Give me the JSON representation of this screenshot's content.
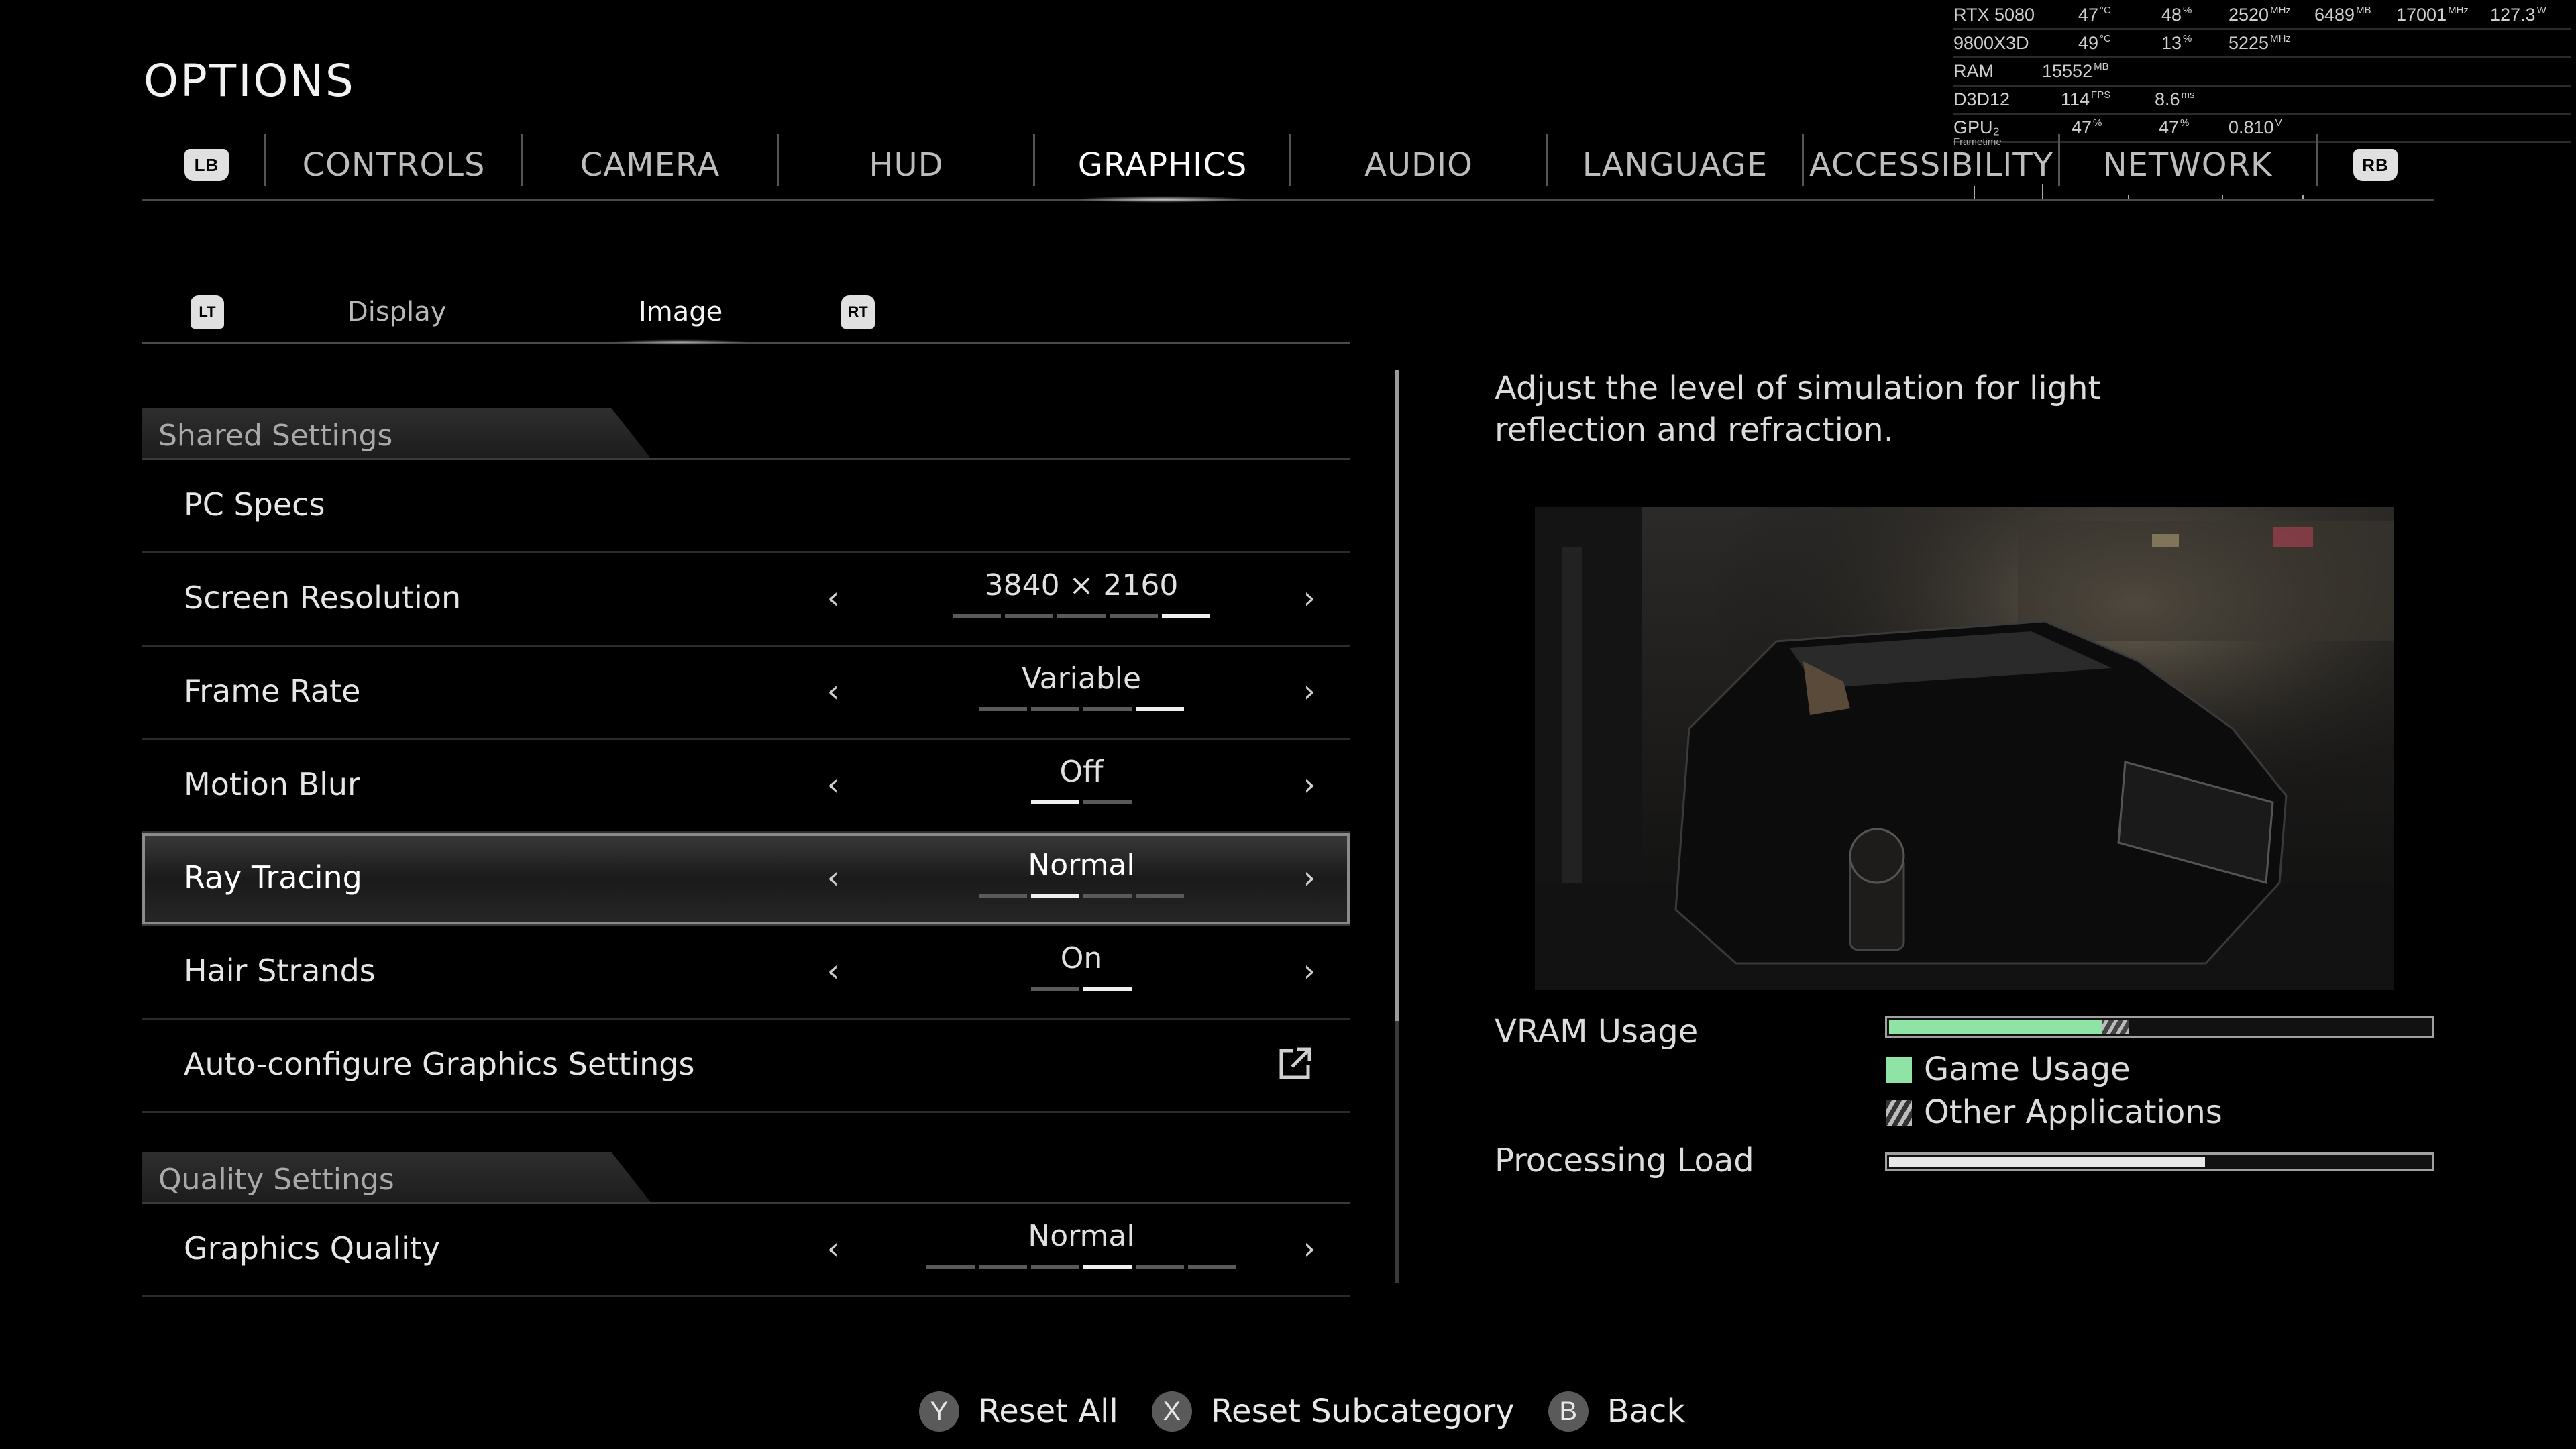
{
  "osd": {
    "rows": [
      [
        "RTX 5080",
        "47",
        "°C",
        "48",
        "%",
        "2520",
        "MHz",
        "6489",
        "MB",
        "17001",
        "MHz",
        "127.3",
        "W"
      ],
      [
        "9800X3D",
        "49",
        "°C",
        "13",
        "%",
        "5225",
        "MHz"
      ],
      [
        "RAM",
        "15552",
        "MB"
      ],
      [
        "D3D12",
        "114",
        "FPS",
        "8.6",
        "ms"
      ],
      [
        "GPU₂",
        "47",
        "%",
        "47",
        "%",
        "0.810",
        "V"
      ]
    ],
    "frametime_label": "Frametime"
  },
  "title": "OPTIONS",
  "main_tabs": {
    "left_bumper": "LB",
    "right_bumper": "RB",
    "items": [
      "CONTROLS",
      "CAMERA",
      "HUD",
      "GRAPHICS",
      "AUDIO",
      "LANGUAGE",
      "ACCESSIBILITY",
      "NETWORK"
    ],
    "active": "GRAPHICS"
  },
  "sub_tabs": {
    "left_trigger": "LT",
    "right_trigger": "RT",
    "items": [
      "Display",
      "Image"
    ],
    "active": "Image"
  },
  "sections": {
    "shared": {
      "title": "Shared Settings",
      "rows": [
        {
          "label": "PC Specs"
        },
        {
          "label": "Screen Resolution",
          "value": "3840 × 2160",
          "pips": 5,
          "selected_pip": 5
        },
        {
          "label": "Frame Rate",
          "value": "Variable",
          "pips": 4,
          "selected_pip": 4
        },
        {
          "label": "Motion Blur",
          "value": "Off",
          "pips": 2,
          "selected_pip": 1
        },
        {
          "label": "Ray Tracing",
          "value": "Normal",
          "pips": 4,
          "selected_pip": 2
        },
        {
          "label": "Hair Strands",
          "value": "On",
          "pips": 2,
          "selected_pip": 2
        },
        {
          "label": "Auto-configure Graphics Settings"
        }
      ]
    },
    "quality": {
      "title": "Quality Settings",
      "rows": [
        {
          "label": "Graphics Quality",
          "value": "Normal",
          "pips": 6,
          "selected_pip": 4
        }
      ]
    }
  },
  "arrows": {
    "left": "‹",
    "right": "›"
  },
  "description": "Adjust the level of simulation for light reflection and refraction.",
  "meters": {
    "vram_label": "VRAM Usage",
    "vram_game_fraction": 0.39,
    "vram_other_fraction": 0.05,
    "legend_game": "Game Usage",
    "legend_other": "Other Applications",
    "processing_label": "Processing Load",
    "processing_fraction": 0.58,
    "game_color": "#8fe3a4"
  },
  "hints": [
    {
      "button": "Y",
      "label": "Reset All"
    },
    {
      "button": "X",
      "label": "Reset Subcategory"
    },
    {
      "button": "B",
      "label": "Back"
    }
  ]
}
